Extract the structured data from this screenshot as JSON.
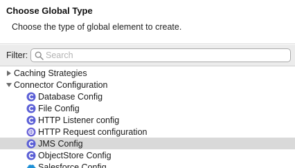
{
  "header": {
    "title": "Choose Global Type",
    "description": "Choose the type of global element to create."
  },
  "filter": {
    "label": "Filter:",
    "placeholder": "Search",
    "value": ""
  },
  "tree": {
    "categories": [
      {
        "label": "Caching Strategies",
        "expanded": false
      },
      {
        "label": "Connector Configuration",
        "expanded": true
      }
    ],
    "items": [
      {
        "label": "Database Config",
        "icon": "connector-c-icon",
        "selected": false
      },
      {
        "label": "File Config",
        "icon": "connector-c-icon",
        "selected": false
      },
      {
        "label": "HTTP Listener config",
        "icon": "connector-c-icon",
        "selected": false
      },
      {
        "label": "HTTP Request configuration",
        "icon": "globe-connector-icon",
        "selected": false
      },
      {
        "label": "JMS Config",
        "icon": "connector-c-icon",
        "selected": true
      },
      {
        "label": "ObjectStore Config",
        "icon": "connector-c-icon",
        "selected": false
      },
      {
        "label": "Salesforce Config",
        "icon": "salesforce-cloud-icon",
        "selected": false
      }
    ]
  },
  "colors": {
    "connector_icon": "#5b5fd6",
    "selection": "#d9d9d9",
    "panel_background": "#ececec"
  }
}
